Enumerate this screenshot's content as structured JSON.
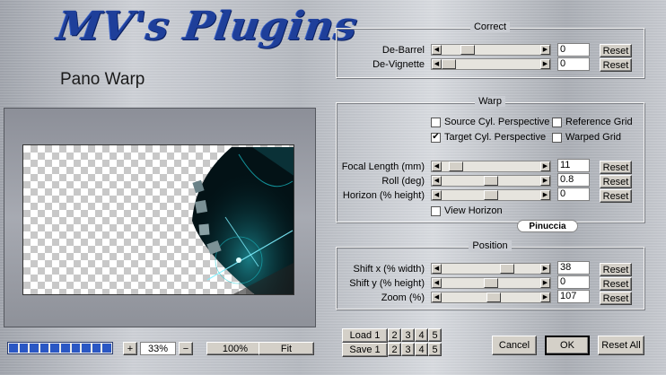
{
  "header": {
    "logo_text": "MV's Plugins",
    "title": "Pano Warp"
  },
  "correct": {
    "title": "Correct",
    "rows": [
      {
        "label": "De-Barrel",
        "value": "0",
        "reset": "Reset",
        "level": 0.22
      },
      {
        "label": "De-Vignette",
        "value": "0",
        "reset": "Reset",
        "level": 0.0
      }
    ]
  },
  "warp": {
    "title": "Warp",
    "checkboxes": [
      {
        "label": "Source Cyl. Perspective",
        "checked": false
      },
      {
        "label": "Reference Grid",
        "checked": false
      },
      {
        "label": "Target Cyl. Perspective",
        "checked": true
      },
      {
        "label": "Warped Grid",
        "checked": false
      }
    ],
    "rows": [
      {
        "label": "Focal Length (mm)",
        "value": "11",
        "reset": "Reset",
        "level": 0.08
      },
      {
        "label": "Roll (deg)",
        "value": "0.8",
        "reset": "Reset",
        "level": 0.5
      },
      {
        "label": "Horizon (% height)",
        "value": "0",
        "reset": "Reset",
        "level": 0.5
      }
    ],
    "view_horizon": {
      "label": "View Horizon",
      "checked": false
    }
  },
  "badge": {
    "text": "Pinuccia"
  },
  "position": {
    "title": "Position",
    "rows": [
      {
        "label": "Shift x (% width)",
        "value": "38",
        "reset": "Reset",
        "level": 0.69
      },
      {
        "label": "Shift y (% height)",
        "value": "0",
        "reset": "Reset",
        "level": 0.5
      },
      {
        "label": "Zoom (%)",
        "value": "107",
        "reset": "Reset",
        "level": 0.53
      }
    ]
  },
  "preview": {
    "zoom_plus": "+",
    "zoom_value": "33%",
    "zoom_minus": "−",
    "zoom_100": "100%",
    "zoom_fit": "Fit",
    "progress_segments": 10
  },
  "presets": {
    "load_label": "Load 1",
    "save_label": "Save 1",
    "slots": [
      "2",
      "3",
      "4",
      "5"
    ]
  },
  "footer": {
    "cancel": "Cancel",
    "ok": "OK",
    "reset_all": "Reset All"
  },
  "colors": {
    "logo": "#1e3f9a",
    "progress": "#2a57c4",
    "image_teal": "#19c8d2"
  }
}
